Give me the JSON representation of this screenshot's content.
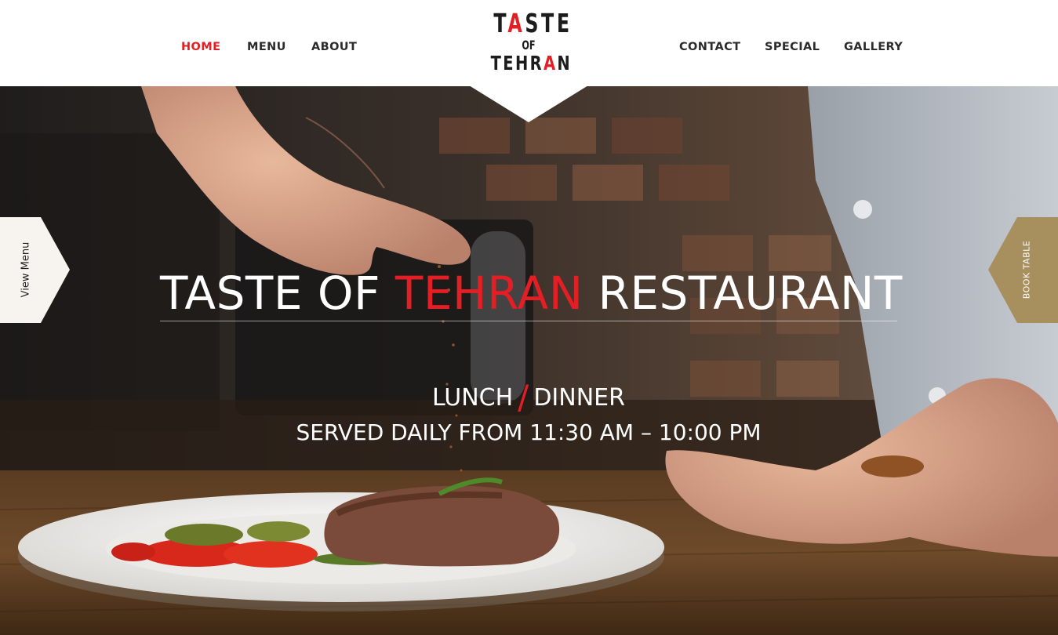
{
  "nav": {
    "home": "HOME",
    "menu": "MENU",
    "about": "ABOUT",
    "contact": "CONTACT",
    "special": "SPECIAL",
    "gallery": "GALLERY"
  },
  "logo": {
    "line1_a": "T",
    "line1_accent": "A",
    "line1_b": "STE",
    "line2": "OF",
    "line3_a": "TEHR",
    "line3_accent": "A",
    "line3_b": "N"
  },
  "hero": {
    "title_part1": "TASTE OF ",
    "title_accent": "TEHRAN",
    "title_part2": " RESTAURANT",
    "meal_1": "LUNCH",
    "meal_divider": "/",
    "meal_2": "DINNER",
    "hours": "SERVED DAILY FROM 11:30 AM – 10:00 PM"
  },
  "side_tabs": {
    "left": "View Menu",
    "right": "BOOK TABLE"
  },
  "colors": {
    "accent_red": "#e31e24",
    "book_table_gold": "#a88f5e",
    "header_bg": "#ffffff",
    "nav_text": "#2b2b2b"
  }
}
